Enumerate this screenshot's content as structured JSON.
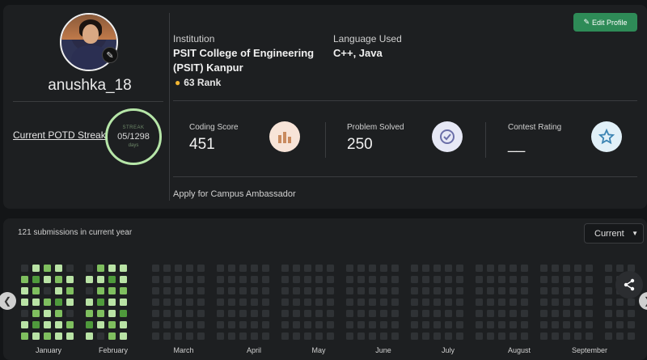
{
  "profile": {
    "username": "anushka_18",
    "potd_label": "Current POTD Streak",
    "streak": {
      "caption": "STREAK",
      "value": "05/1298",
      "unit": "days"
    },
    "institution_label": "Institution",
    "institution_name": "PSIT College of Engineering (PSIT) Kanpur",
    "language_label": "Language Used",
    "languages": "C++, Java",
    "rank_text": "63 Rank",
    "edit_button": "Edit Profile",
    "ambassador_link": "Apply for Campus Ambassador"
  },
  "stats": [
    {
      "label": "Coding Score",
      "value": "451",
      "icon": "bar-chart-icon"
    },
    {
      "label": "Problem Solved",
      "value": "250",
      "icon": "check-circle-icon"
    },
    {
      "label": "Contest Rating",
      "value": "__",
      "icon": "star-icon"
    }
  ],
  "heatmap": {
    "submissions_text": "121 submissions in current year",
    "selected_period": "Current",
    "months": [
      "January",
      "February",
      "March",
      "April",
      "May",
      "June",
      "July",
      "August",
      "September"
    ],
    "colors": {
      "empty": "#2f3235",
      "level1": "#b9e3a5",
      "level2": "#7fbf5f",
      "level3": "#4f9a3c",
      "level4": "#2d6a2a"
    }
  }
}
